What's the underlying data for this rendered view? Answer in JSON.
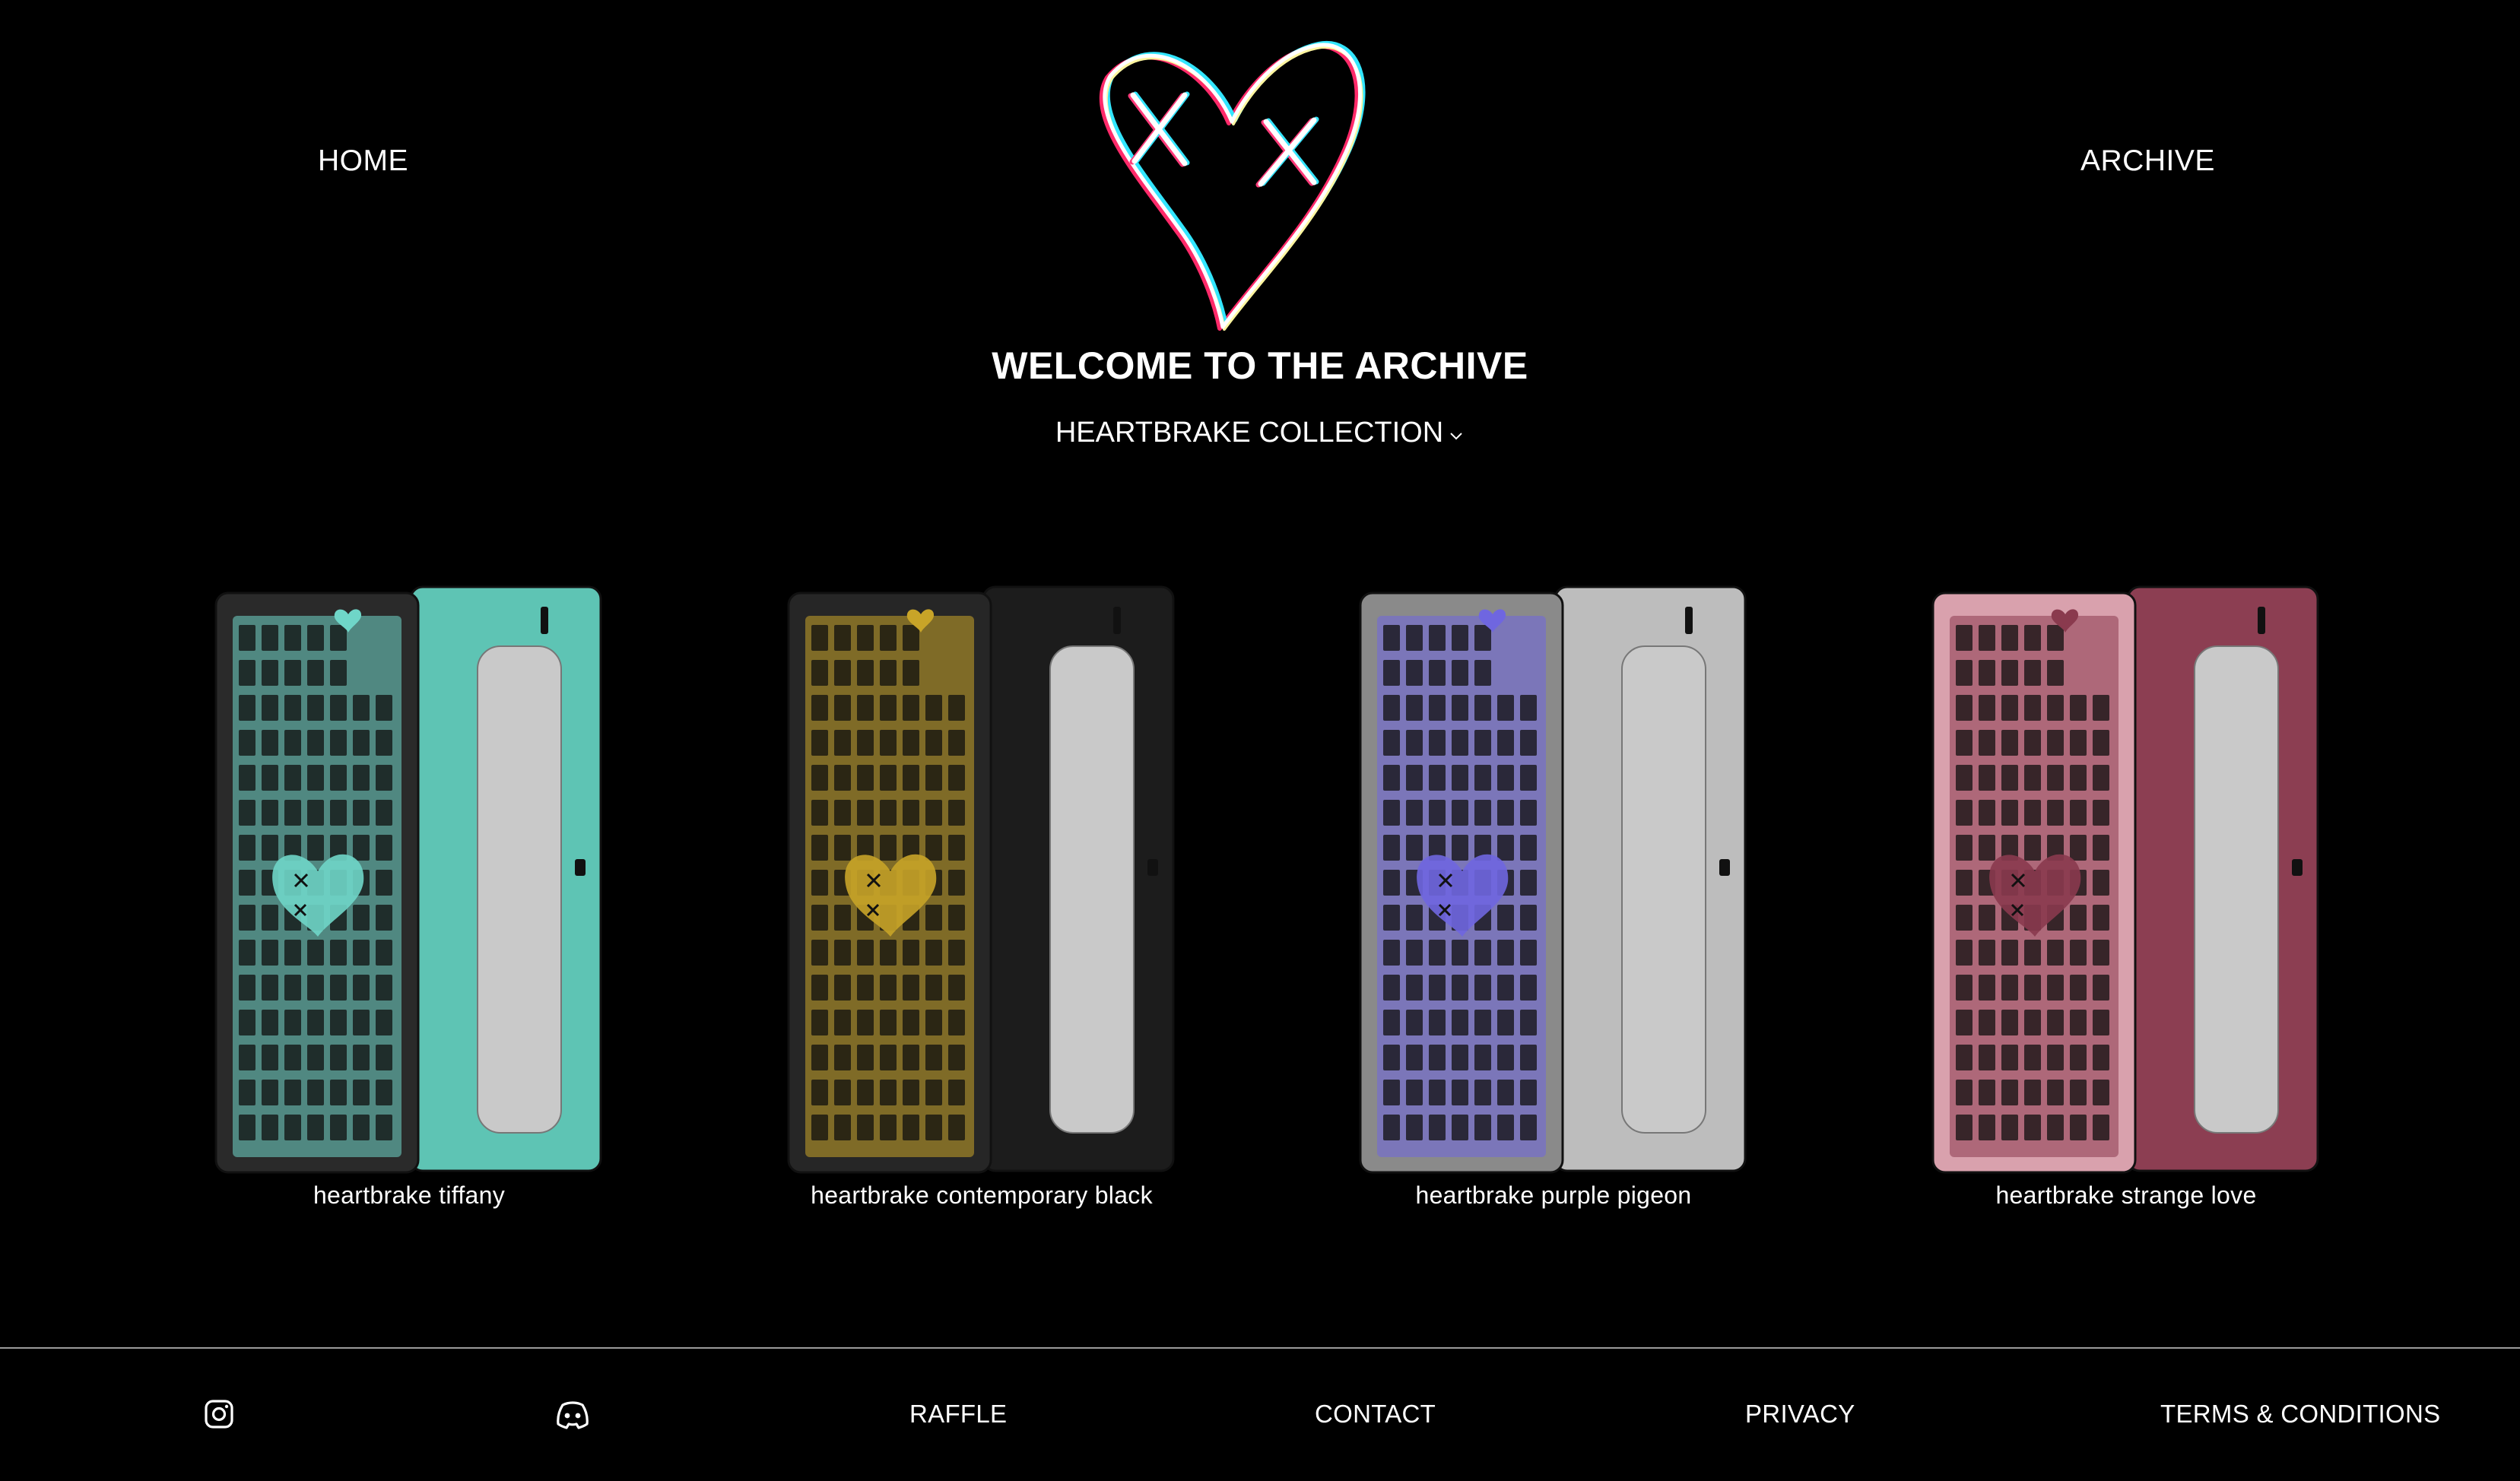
{
  "header": {
    "home_label": "HOME",
    "archive_label": "ARCHIVE",
    "logo_icon": "heart-with-x-eyes-logo",
    "welcome_title": "WELCOME TO THE ARCHIVE",
    "collection_label": "HEARTBRAKE COLLECTION"
  },
  "products": [
    {
      "name": "heartbrake tiffany",
      "accent": "#6fd6c8",
      "case": "#2a2a2a",
      "back": "#5ec4b4"
    },
    {
      "name": "heartbrake contemporary black",
      "accent": "#c8a428",
      "case": "#262626",
      "back": "#1c1c1c"
    },
    {
      "name": "heartbrake purple pigeon",
      "accent": "#6f66e0",
      "case": "#8a8a8a",
      "back": "#bdbdbd"
    },
    {
      "name": "heartbrake strange love",
      "accent": "#8a3a4e",
      "case": "#d9a1ad",
      "back": "#8c3e52"
    }
  ],
  "footer": {
    "instagram_icon": "instagram-icon",
    "discord_icon": "discord-icon",
    "raffle_label": "RAFFLE",
    "contact_label": "CONTACT",
    "privacy_label": "PRIVACY",
    "terms_label": "TERMS & CONDITIONS"
  }
}
